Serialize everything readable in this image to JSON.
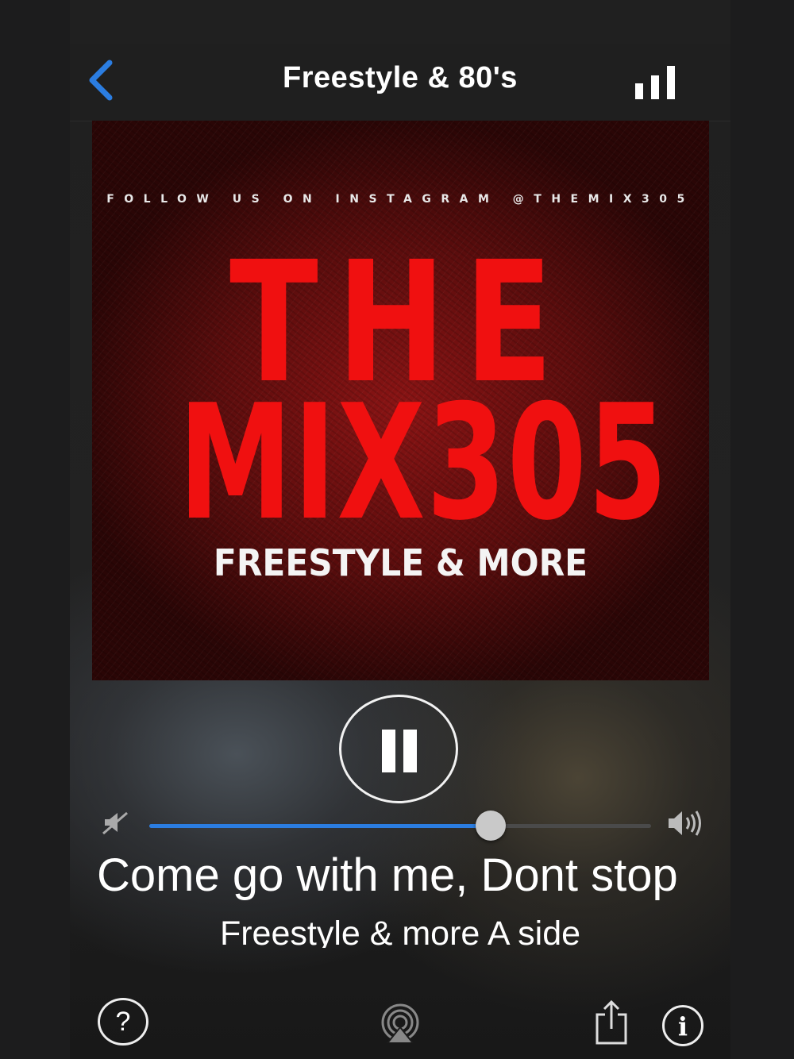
{
  "header": {
    "title": "Freestyle & 80's",
    "back_icon": "chevron-left-icon",
    "bars_icon": "signal-bars-icon",
    "accent_color": "#2b7de1"
  },
  "album_art": {
    "follow_text": "FOLLOW US ON INSTAGRAM @THEMIX305",
    "line1": "THE",
    "line2": "MIX305",
    "line3": "FREESTYLE & MORE"
  },
  "player": {
    "state": "playing",
    "pause_icon": "pause-icon",
    "volume_level": 0.68,
    "volume_min_icon": "speaker-mute-icon",
    "volume_max_icon": "speaker-loud-icon"
  },
  "now_playing": {
    "title": "Come go with me, Dont stop",
    "subtitle": "Freestyle & more A side"
  },
  "footer": {
    "help_label": "?",
    "airplay_icon": "airplay-icon",
    "share_icon": "share-icon",
    "info_label": "i"
  }
}
